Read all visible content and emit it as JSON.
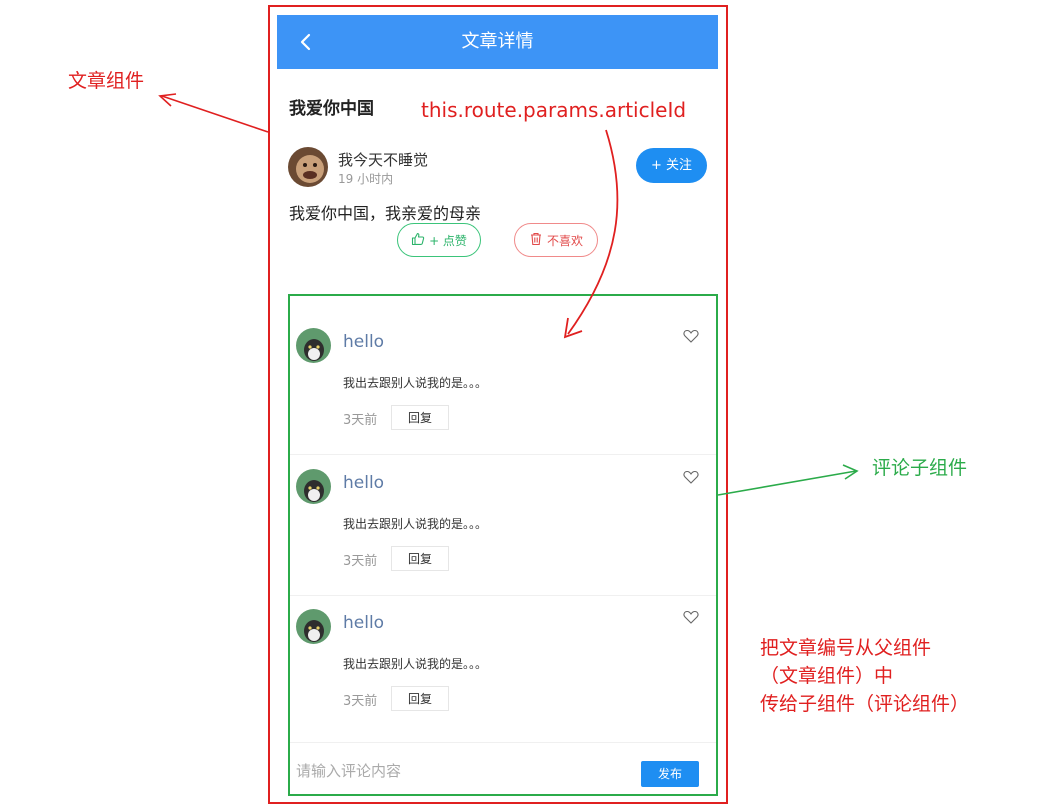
{
  "nav": {
    "title": "文章详情",
    "back_icon": "chevron-left-icon"
  },
  "article": {
    "title": "我爱你中国",
    "author_name": "我今天不睡觉",
    "time": "19 小时内",
    "follow_label": "+ 关注",
    "body": "我爱你中国，我亲爱的母亲",
    "like_label": "+ 点赞",
    "dislike_label": "不喜欢"
  },
  "comments": [
    {
      "name": "hello",
      "text": "我出去跟别人说我的是。。。",
      "time": "3天前",
      "reply_label": "回复"
    },
    {
      "name": "hello",
      "text": "我出去跟别人说我的是。。。",
      "time": "3天前",
      "reply_label": "回复"
    },
    {
      "name": "hello",
      "text": "我出去跟别人说我的是。。。",
      "time": "3天前",
      "reply_label": "回复"
    }
  ],
  "comment_box": {
    "placeholder": "请输入评论内容",
    "publish_label": "发布"
  },
  "annotations": {
    "article_component": "文章组件",
    "route_param": "this.route.params.articleId",
    "comment_child": "评论子组件",
    "note_line1": "把文章编号从父组件",
    "note_line2": "（文章组件）中",
    "note_line3": "传给子组件（评论组件）"
  },
  "colors": {
    "primary": "#3d94f6",
    "annotation_red": "#e02020",
    "annotation_green": "#2bab4a"
  }
}
